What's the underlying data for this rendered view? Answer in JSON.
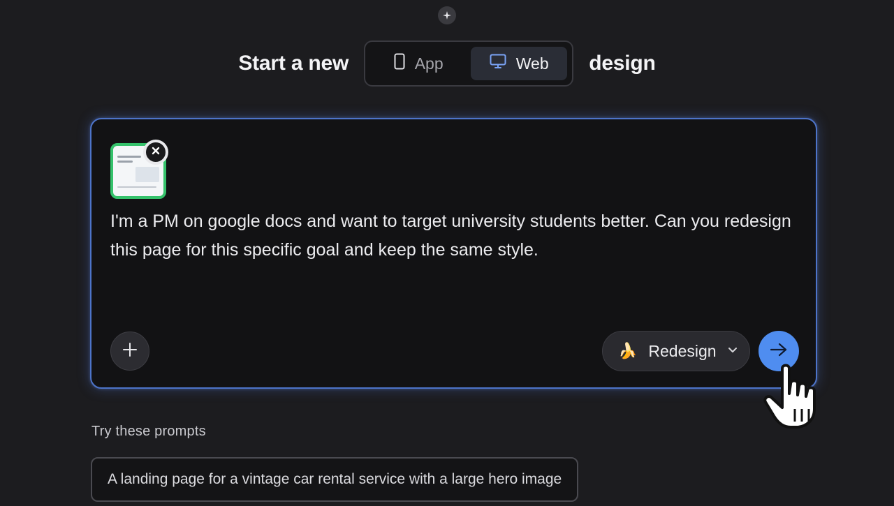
{
  "header": {
    "title_prefix": "Start a new",
    "title_suffix": "design",
    "tabs": [
      {
        "label": "App",
        "icon": "phone-icon",
        "active": false
      },
      {
        "label": "Web",
        "icon": "monitor-icon",
        "active": true
      }
    ]
  },
  "composer": {
    "text": "I'm a PM on google docs and want to target university students better. Can you redesign this page for this specific goal and keep the same style.",
    "attachment": {
      "type": "screenshot-thumbnail",
      "icon": "close-icon"
    },
    "mode": {
      "emoji": "🍌",
      "label": "Redesign"
    },
    "add_icon": "plus-icon",
    "send_icon": "arrow-right-icon"
  },
  "suggestions": {
    "label": "Try these prompts",
    "items": [
      "A landing page for a vintage car rental service with a large hero image"
    ]
  },
  "colors": {
    "accent": "#4f8df0",
    "attachment_border": "#35c26b",
    "composer_border": "#4d74c9"
  }
}
